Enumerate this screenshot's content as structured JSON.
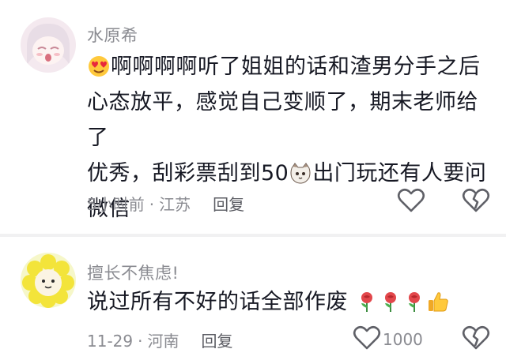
{
  "comments": [
    {
      "username": "水原希",
      "text_line1": "啊啊啊啊听了姐姐的话和渣男分手之后",
      "text_line2": "心态放平，感觉自己变顺了，期末老师给了",
      "text_line3a": "优秀，刮彩票刮到50",
      "text_line3b": "出门玩还有人要问",
      "text_line4": "微信",
      "time": "5小时前",
      "separator": "·",
      "location": "江苏",
      "reply_label": "回复"
    },
    {
      "username": "擅长不焦虑!",
      "text": "说过所有不好的话全部作废",
      "time": "11-29",
      "separator": "·",
      "location": "河南",
      "reply_label": "回复",
      "like_count": "1000"
    }
  ],
  "icons": {
    "like": "heart-outline-icon",
    "dislike": "broken-heart-icon",
    "emoji_love": "heart-eyes-emoji",
    "emoji_cat": "cat-face-emoji",
    "emoji_rose": "rose-emoji",
    "emoji_thumbs": "thumbs-up-emoji"
  },
  "colors": {
    "text": "#161823",
    "secondary": "#8a8b91",
    "divider": "#f1f1f2"
  }
}
